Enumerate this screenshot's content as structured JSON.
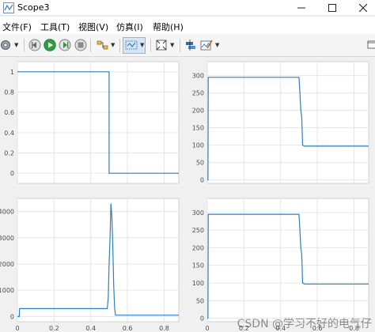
{
  "window": {
    "title": "Scope3"
  },
  "menu": {
    "items": [
      "文件(F)",
      "工具(T)",
      "视图(V)",
      "仿真(I)",
      "帮助(H)"
    ]
  },
  "colors": {
    "line": "#2f7fbf",
    "plot_bg": "#ffffff",
    "grid": "#e6e6e6",
    "axis": "#d0d0d0"
  },
  "toolbar": {
    "icons": [
      "settings-icon",
      "back-icon",
      "run-icon",
      "step-forward-icon",
      "stop-icon",
      "highlight-icon",
      "zoom-icon",
      "fit-icon",
      "cursor-icon",
      "edit-icon"
    ]
  },
  "watermark": "CSDN @学习不好的电气仔",
  "plots": [
    {
      "id": "p1",
      "xlim": [
        0,
        0.88
      ],
      "ylim": [
        -0.1,
        1.1
      ],
      "yticks": [
        0,
        0.2,
        0.4,
        0.6,
        0.8,
        1
      ],
      "ytick_labels": [
        "0",
        "0.2",
        "0.4",
        "0.6",
        "0.8",
        "1"
      ],
      "xticks": [
        0,
        0.2,
        0.4,
        0.6,
        0.8
      ],
      "xtick_labels": [],
      "points": [
        [
          0,
          1
        ],
        [
          0.5,
          1
        ],
        [
          0.5,
          0
        ],
        [
          0.88,
          0
        ]
      ]
    },
    {
      "id": "p2",
      "xlim": [
        0,
        0.88
      ],
      "ylim": [
        -10,
        340
      ],
      "yticks": [
        0,
        50,
        100,
        150,
        200,
        250,
        300
      ],
      "ytick_labels": [
        "0",
        "50",
        "100",
        "150",
        "200",
        "250",
        "300"
      ],
      "xticks": [
        0,
        0.2,
        0.4,
        0.6,
        0.8
      ],
      "xtick_labels": [],
      "points": [
        [
          0,
          0
        ],
        [
          0.004,
          0
        ],
        [
          0.005,
          295
        ],
        [
          0.5,
          295
        ],
        [
          0.505,
          250
        ],
        [
          0.51,
          200
        ],
        [
          0.515,
          180
        ],
        [
          0.52,
          100
        ],
        [
          0.53,
          97
        ],
        [
          0.88,
          97
        ]
      ]
    },
    {
      "id": "p3",
      "xlim": [
        0,
        0.88
      ],
      "ylim": [
        -200,
        4500
      ],
      "yticks": [
        0,
        1000,
        2000,
        3000,
        4000
      ],
      "ytick_labels": [
        "0",
        "1000",
        "2000",
        "3000",
        "4000"
      ],
      "xticks": [
        0,
        0.2,
        0.4,
        0.6,
        0.8
      ],
      "xtick_labels": [
        "0",
        "0.2",
        "0.4",
        "0.6",
        "0.8"
      ],
      "points": [
        [
          0,
          0
        ],
        [
          0.01,
          0
        ],
        [
          0.012,
          300
        ],
        [
          0.49,
          300
        ],
        [
          0.495,
          700
        ],
        [
          0.5,
          2000
        ],
        [
          0.505,
          3000
        ],
        [
          0.51,
          4300
        ],
        [
          0.515,
          3800
        ],
        [
          0.52,
          2800
        ],
        [
          0.525,
          1200
        ],
        [
          0.53,
          300
        ],
        [
          0.535,
          50
        ],
        [
          0.88,
          50
        ]
      ]
    },
    {
      "id": "p4",
      "xlim": [
        0,
        0.88
      ],
      "ylim": [
        -10,
        340
      ],
      "yticks": [
        0,
        50,
        100,
        150,
        200,
        250,
        300
      ],
      "ytick_labels": [
        "0",
        "50",
        "100",
        "150",
        "200",
        "250",
        "300"
      ],
      "xticks": [
        0,
        0.2,
        0.4,
        0.6,
        0.8
      ],
      "xtick_labels": [
        "0",
        "0.2",
        "0.4",
        "0.6",
        "0.8"
      ],
      "points": [
        [
          0,
          0
        ],
        [
          0.004,
          0
        ],
        [
          0.005,
          295
        ],
        [
          0.5,
          295
        ],
        [
          0.505,
          250
        ],
        [
          0.51,
          200
        ],
        [
          0.515,
          180
        ],
        [
          0.52,
          100
        ],
        [
          0.53,
          97
        ],
        [
          0.88,
          97
        ]
      ]
    }
  ]
}
